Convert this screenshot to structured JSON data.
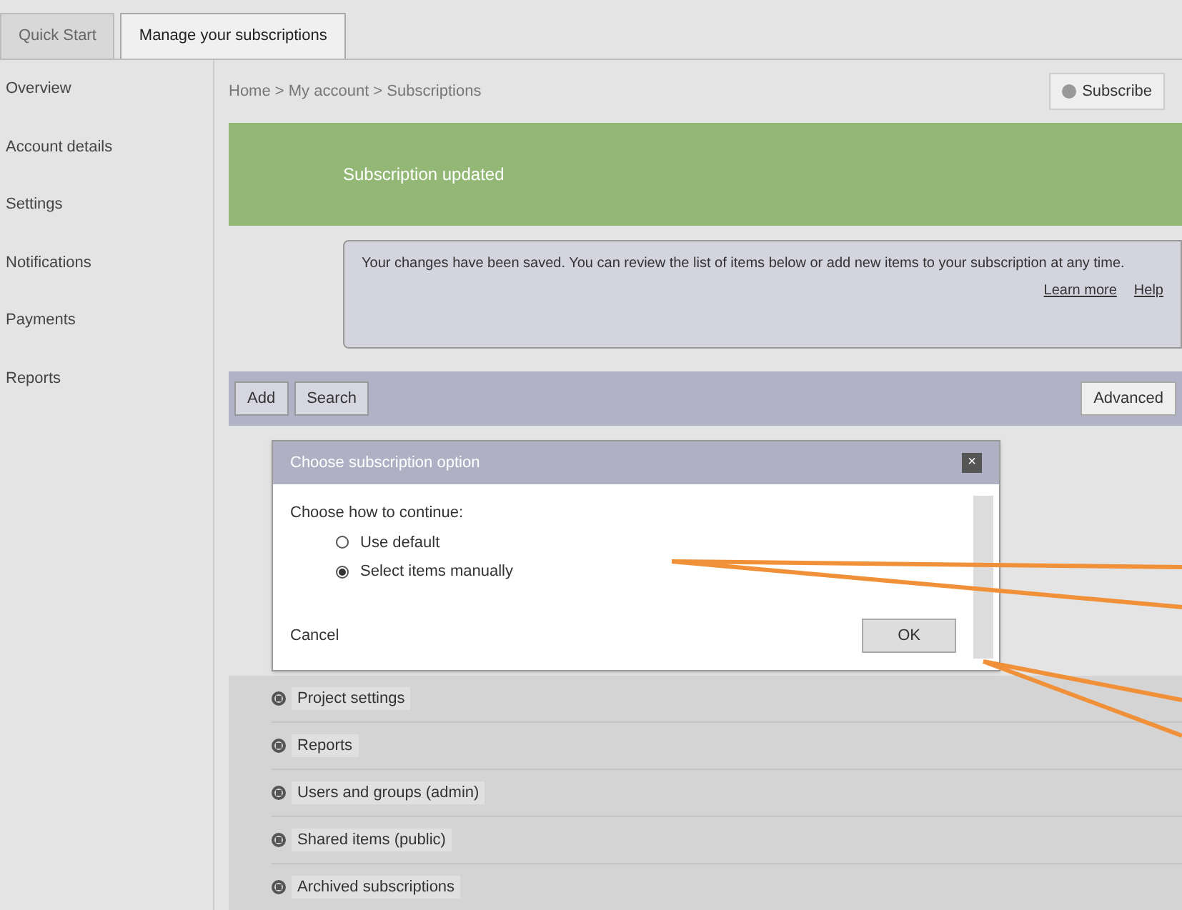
{
  "tabs": [
    {
      "label": "Quick Start",
      "selected": false
    },
    {
      "label": "Manage your subscriptions",
      "selected": true
    }
  ],
  "subscribe_button": "Subscribe",
  "breadcrumb": "Home > My account > Subscriptions",
  "sidebar": {
    "items": [
      {
        "label": "Overview"
      },
      {
        "label": "Account details"
      },
      {
        "label": "Settings"
      },
      {
        "label": "Notifications"
      },
      {
        "label": "Payments"
      },
      {
        "label": "Reports"
      }
    ]
  },
  "banner": {
    "title": "Subscription updated"
  },
  "info": {
    "text": "Your changes have been saved. You can review the list of items below or add new items to your subscription at any time.",
    "links": [
      "Learn more",
      "Help"
    ]
  },
  "toolbar": {
    "buttons": [
      "Add",
      "Search"
    ],
    "right_button": "Advanced"
  },
  "dialog": {
    "title": "Choose subscription option",
    "prompt": "Choose how to continue:",
    "options": [
      {
        "label": "Use default",
        "selected": false
      },
      {
        "label": "Select items manually",
        "selected": true
      }
    ],
    "cancel": "Cancel",
    "ok": "OK",
    "close": "×"
  },
  "list": [
    {
      "label": "Project settings",
      "expanded": false
    },
    {
      "label": "Reports",
      "expanded": false
    },
    {
      "label": "Users and groups (admin)",
      "expanded": false
    },
    {
      "label": "Shared items (public)",
      "expanded": false
    },
    {
      "label": "Archived subscriptions",
      "expanded": false
    }
  ]
}
